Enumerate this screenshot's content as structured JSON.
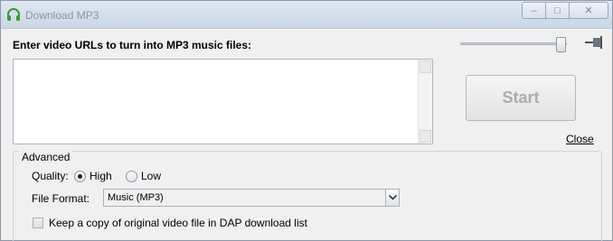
{
  "window": {
    "title": "Download MP3",
    "controls": {
      "minimize": "–",
      "maximize": "□",
      "close": "✕"
    }
  },
  "main": {
    "prompt": "Enter video URLs to turn into MP3 music files:",
    "url_value": "",
    "start_label": "Start",
    "close_label": "Close"
  },
  "advanced": {
    "legend": "Advanced",
    "quality_label": "Quality:",
    "quality_options": [
      "High",
      "Low"
    ],
    "quality_selected": "High",
    "format_label": "File Format:",
    "format_value": "Music (MP3)",
    "keep_copy_label": "Keep a copy of original video file in DAP download list",
    "keep_copy_checked": false
  },
  "colors": {
    "icon_green": "#3c9a3c",
    "title_text": "#8b97a6"
  },
  "icons": [
    "headphones-icon",
    "pin-icon",
    "chevron-down-icon"
  ]
}
